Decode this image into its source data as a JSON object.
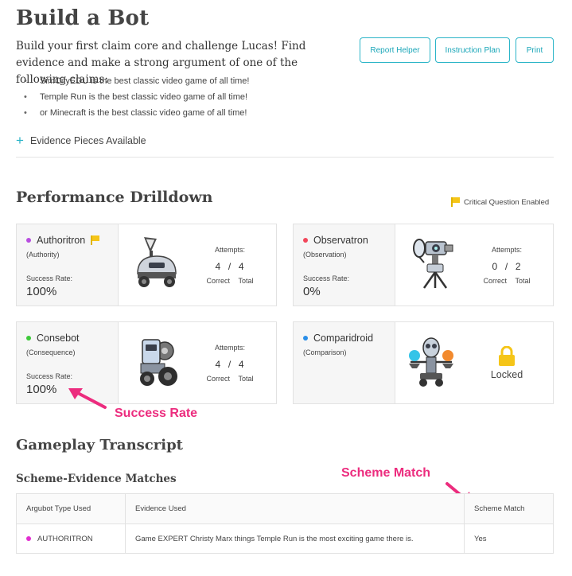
{
  "header": {
    "title": "Build a Bot",
    "intro": "Build your first claim core and challenge Lucas! Find evidence and make a strong argument of one of the following claims:",
    "claims": [
      "SimCityEDU is the best classic video game of all time!",
      "Temple Run is the best classic video game of all time!",
      "or Minecraft is the best classic video game of all time!"
    ],
    "buttons": {
      "report_helper": "Report Helper",
      "instruction_plan": "Instruction Plan",
      "print": "Print"
    },
    "evidence_toggle_icon": "+",
    "evidence_toggle_label": "Evidence Pieces Available"
  },
  "performance": {
    "title": "Performance Drilldown",
    "critical_note": "Critical Question Enabled",
    "cards": {
      "authoritron": {
        "name": "Authoritron",
        "type": "(Authority)",
        "dot_color": "#b84de0",
        "flag": true,
        "success_label": "Success Rate:",
        "success_rate": "100%",
        "attempts_label": "Attempts:",
        "correct": "4",
        "total": "4",
        "separator": "/",
        "correct_label": "Correct",
        "total_label": "Total"
      },
      "observatron": {
        "name": "Observatron",
        "type": "(Observation)",
        "dot_color": "#f2475b",
        "success_label": "Success Rate:",
        "success_rate": "0%",
        "attempts_label": "Attempts:",
        "correct": "0",
        "total": "2",
        "separator": "/",
        "correct_label": "Correct",
        "total_label": "Total"
      },
      "consebot": {
        "name": "Consebot",
        "type": "(Consequence)",
        "dot_color": "#3ec93a",
        "success_label": "Success Rate:",
        "success_rate": "100%",
        "attempts_label": "Attempts:",
        "correct": "4",
        "total": "4",
        "separator": "/",
        "correct_label": "Correct",
        "total_label": "Total"
      },
      "comparidroid": {
        "name": "Comparidroid",
        "type": "(Comparison)",
        "dot_color": "#2a8ee8",
        "status": "Locked"
      }
    }
  },
  "annotations": {
    "success_rate": "Success Rate",
    "scheme_match": "Scheme Match",
    "color": "#ec2c7e"
  },
  "transcript": {
    "title": "Gameplay Transcript",
    "matches_title": "Scheme-Evidence Matches",
    "columns": [
      "Argubot Type Used",
      "Evidence Used",
      "Scheme Match"
    ],
    "rows": [
      {
        "type": "AUTHORITRON",
        "dot_color": "#e22fd0",
        "evidence": "Game EXPERT Christy Marx things Temple Run is the most exciting game there is.",
        "match": "Yes"
      }
    ]
  },
  "colors": {
    "accent": "#2cb5c8",
    "flag": "#f5c518"
  }
}
